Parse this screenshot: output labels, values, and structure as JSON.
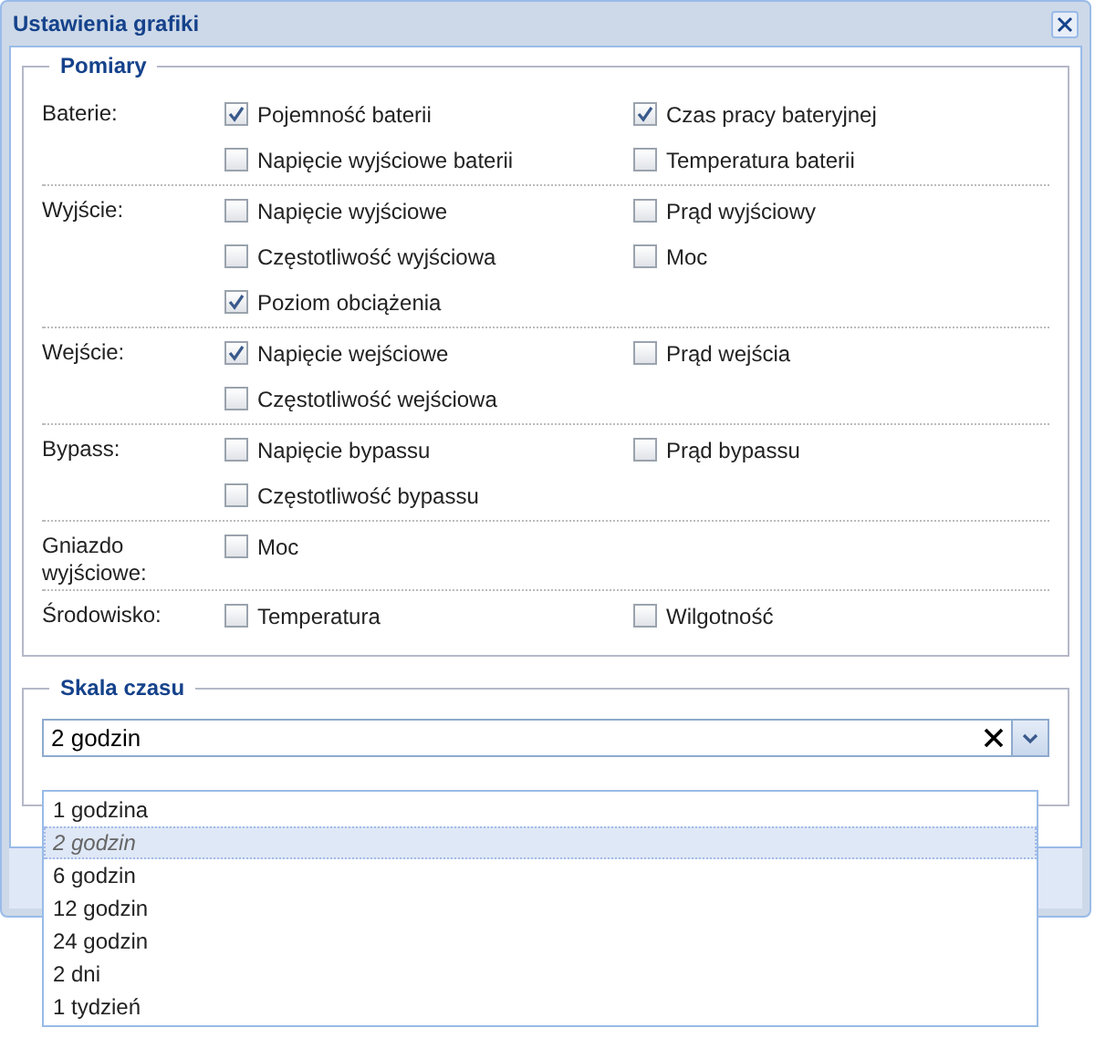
{
  "window": {
    "title": "Ustawienia grafiki"
  },
  "measurements": {
    "legend": "Pomiary",
    "groups": [
      {
        "label": "Baterie:",
        "options": [
          {
            "label": "Pojemność baterii",
            "checked": true
          },
          {
            "label": "Czas pracy bateryjnej",
            "checked": true
          },
          {
            "label": "Napięcie wyjściowe baterii",
            "checked": false
          },
          {
            "label": "Temperatura baterii",
            "checked": false
          }
        ]
      },
      {
        "label": "Wyjście:",
        "options": [
          {
            "label": "Napięcie wyjściowe",
            "checked": false
          },
          {
            "label": "Prąd wyjściowy",
            "checked": false
          },
          {
            "label": "Częstotliwość wyjściowa",
            "checked": false
          },
          {
            "label": "Moc",
            "checked": false
          },
          {
            "label": "Poziom obciążenia",
            "checked": true
          }
        ]
      },
      {
        "label": "Wejście:",
        "options": [
          {
            "label": "Napięcie wejściowe",
            "checked": true
          },
          {
            "label": "Prąd wejścia",
            "checked": false
          },
          {
            "label": "Częstotliwość wejściowa",
            "checked": false
          }
        ]
      },
      {
        "label": "Bypass:",
        "options": [
          {
            "label": "Napięcie bypassu",
            "checked": false
          },
          {
            "label": "Prąd bypassu",
            "checked": false
          },
          {
            "label": "Częstotliwość bypassu",
            "checked": false
          }
        ]
      },
      {
        "label": "Gniazdo wyjściowe:",
        "options": [
          {
            "label": "Moc",
            "checked": false
          }
        ]
      },
      {
        "label": "Środowisko:",
        "options": [
          {
            "label": "Temperatura",
            "checked": false
          },
          {
            "label": "Wilgotność",
            "checked": false
          }
        ]
      }
    ]
  },
  "time_scale": {
    "legend": "Skala czasu",
    "value": "2 godzin",
    "options": [
      {
        "label": "1 godzina",
        "selected": false
      },
      {
        "label": "2 godzin",
        "selected": true
      },
      {
        "label": "6 godzin",
        "selected": false
      },
      {
        "label": "12 godzin",
        "selected": false
      },
      {
        "label": "24 godzin",
        "selected": false
      },
      {
        "label": "2 dni",
        "selected": false
      },
      {
        "label": "1 tydzień",
        "selected": false
      }
    ]
  }
}
